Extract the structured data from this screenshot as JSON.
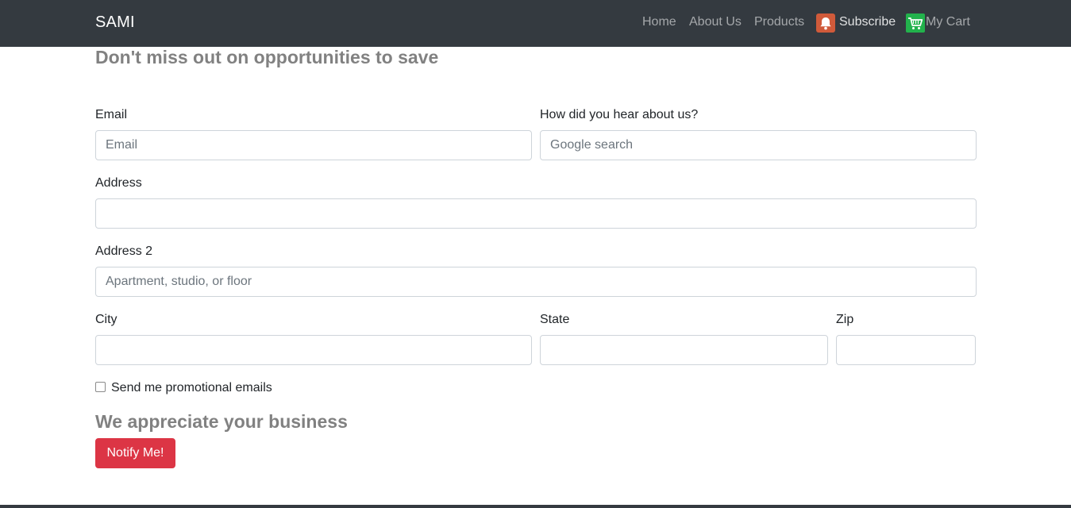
{
  "navbar": {
    "brand": "SAMI",
    "links": [
      "Home",
      "About Us",
      "Products"
    ],
    "subscribe": {
      "label": "Subscribe",
      "icon": "bell-icon"
    },
    "cart": {
      "label": "My Cart",
      "icon": "cart-icon"
    }
  },
  "form": {
    "heading": "Don't miss out on opportunities to save",
    "email": {
      "label": "Email",
      "placeholder": "Email",
      "value": ""
    },
    "hear": {
      "label": "How did you hear about us?",
      "placeholder": "Google search",
      "value": ""
    },
    "address": {
      "label": "Address",
      "placeholder": "",
      "value": ""
    },
    "address2": {
      "label": "Address 2",
      "placeholder": "Apartment, studio, or floor",
      "value": ""
    },
    "city": {
      "label": "City",
      "value": ""
    },
    "state": {
      "label": "State",
      "value": ""
    },
    "zip": {
      "label": "Zip",
      "value": ""
    },
    "promo": {
      "label": "Send me promotional emails",
      "checked": false
    },
    "footer_heading": "We appreciate your business",
    "submit_label": "Notify Me!"
  },
  "colors": {
    "navbar_bg": "#343a40",
    "button_bg": "#dc3545",
    "heading_text": "#818181",
    "subscribe_icon_bg": "#d05a3a",
    "cart_icon_bg": "#22b24c"
  }
}
